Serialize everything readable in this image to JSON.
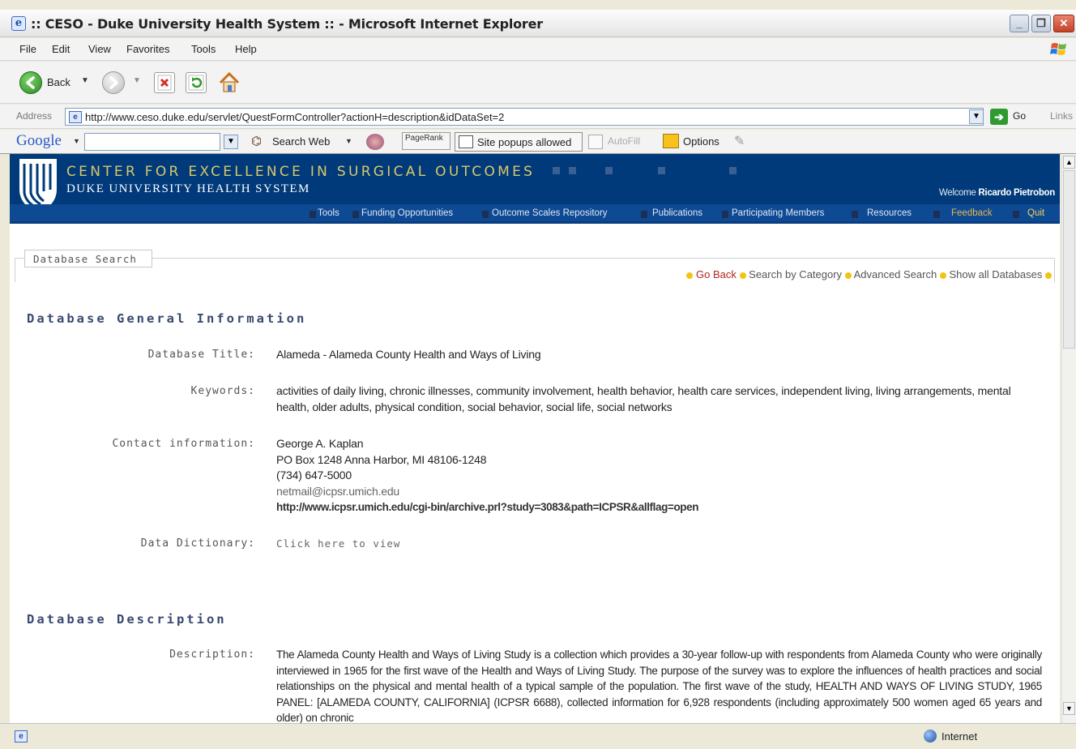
{
  "window": {
    "title": ":: CESO - Duke University Health System :: - Microsoft Internet Explorer"
  },
  "menu": [
    "File",
    "Edit",
    "View",
    "Favorites",
    "Tools",
    "Help"
  ],
  "toolbar": {
    "back_label": "Back"
  },
  "address": {
    "label": "Address",
    "url": "http://www.ceso.duke.edu/servlet/QuestFormController?actionH=description&idDataSet=2",
    "go_label": "Go",
    "links_label": "Links"
  },
  "google_bar": {
    "logo": "Google",
    "search_web": "Search Web",
    "pagerank": "PageRank",
    "popups": "Site popups allowed",
    "autofill": "AutoFill",
    "options": "Options"
  },
  "banner": {
    "line1": "CENTER FOR EXCELLENCE IN SURGICAL OUTCOMES",
    "line2": "DUKE UNIVERSITY HEALTH SYSTEM",
    "welcome_prefix": "Welcome",
    "welcome_user": "Ricardo Pietrobon"
  },
  "nav": [
    "Tools",
    "Funding Opportunities",
    "Outcome Scales Repository",
    "Publications",
    "Participating Members",
    "Resources",
    "Feedback",
    "Quit"
  ],
  "page": {
    "tab_label": "Database Search",
    "links": [
      "Go Back",
      "Search by Category",
      "Advanced Search",
      "Show all Databases"
    ],
    "section1": "Database General Information",
    "title_label": "Database Title:",
    "title_value": "Alameda - Alameda County Health and Ways of Living",
    "keywords_label": "Keywords:",
    "keywords_value": "activities of daily living, chronic illnesses, community involvement, health behavior, health care services, independent living, living arrangements, mental health, older adults, physical condition, social behavior, social life, social networks",
    "contact_label": "Contact information:",
    "contact_name": "George A. Kaplan",
    "contact_address": "PO Box 1248 Anna Harbor, MI 48106-1248",
    "contact_phone": "(734) 647-5000",
    "contact_email": "netmail@icpsr.umich.edu",
    "contact_url": "http://www.icpsr.umich.edu/cgi-bin/archive.prl?study=3083&path=ICPSR&allflag=open",
    "dictionary_label": "Data Dictionary:",
    "dictionary_value": "Click here to view",
    "section2": "Database Description",
    "description_label": "Description:",
    "description_value": "The Alameda County Health and Ways of Living Study is a collection which provides a 30-year follow-up with respondents from Alameda County who were originally interviewed in 1965 for the first wave of the Health and Ways of Living Study. The purpose of the survey was to explore the influences of health practices and social relationships on the physical and mental health of a typical sample of the population. The first wave of the study, HEALTH AND WAYS OF LIVING STUDY, 1965 PANEL: [ALAMEDA COUNTY, CALIFORNIA] (ICPSR 6688), collected information for 6,928 respondents (including approximately 500 women aged 65 years and older) on chronic"
  },
  "status": {
    "zone": "Internet"
  },
  "colors": {
    "banner": "#003a7a",
    "nav": "#0e4a94",
    "accent_yellow": "#f1c40f",
    "feedback": "#e8b74a"
  }
}
